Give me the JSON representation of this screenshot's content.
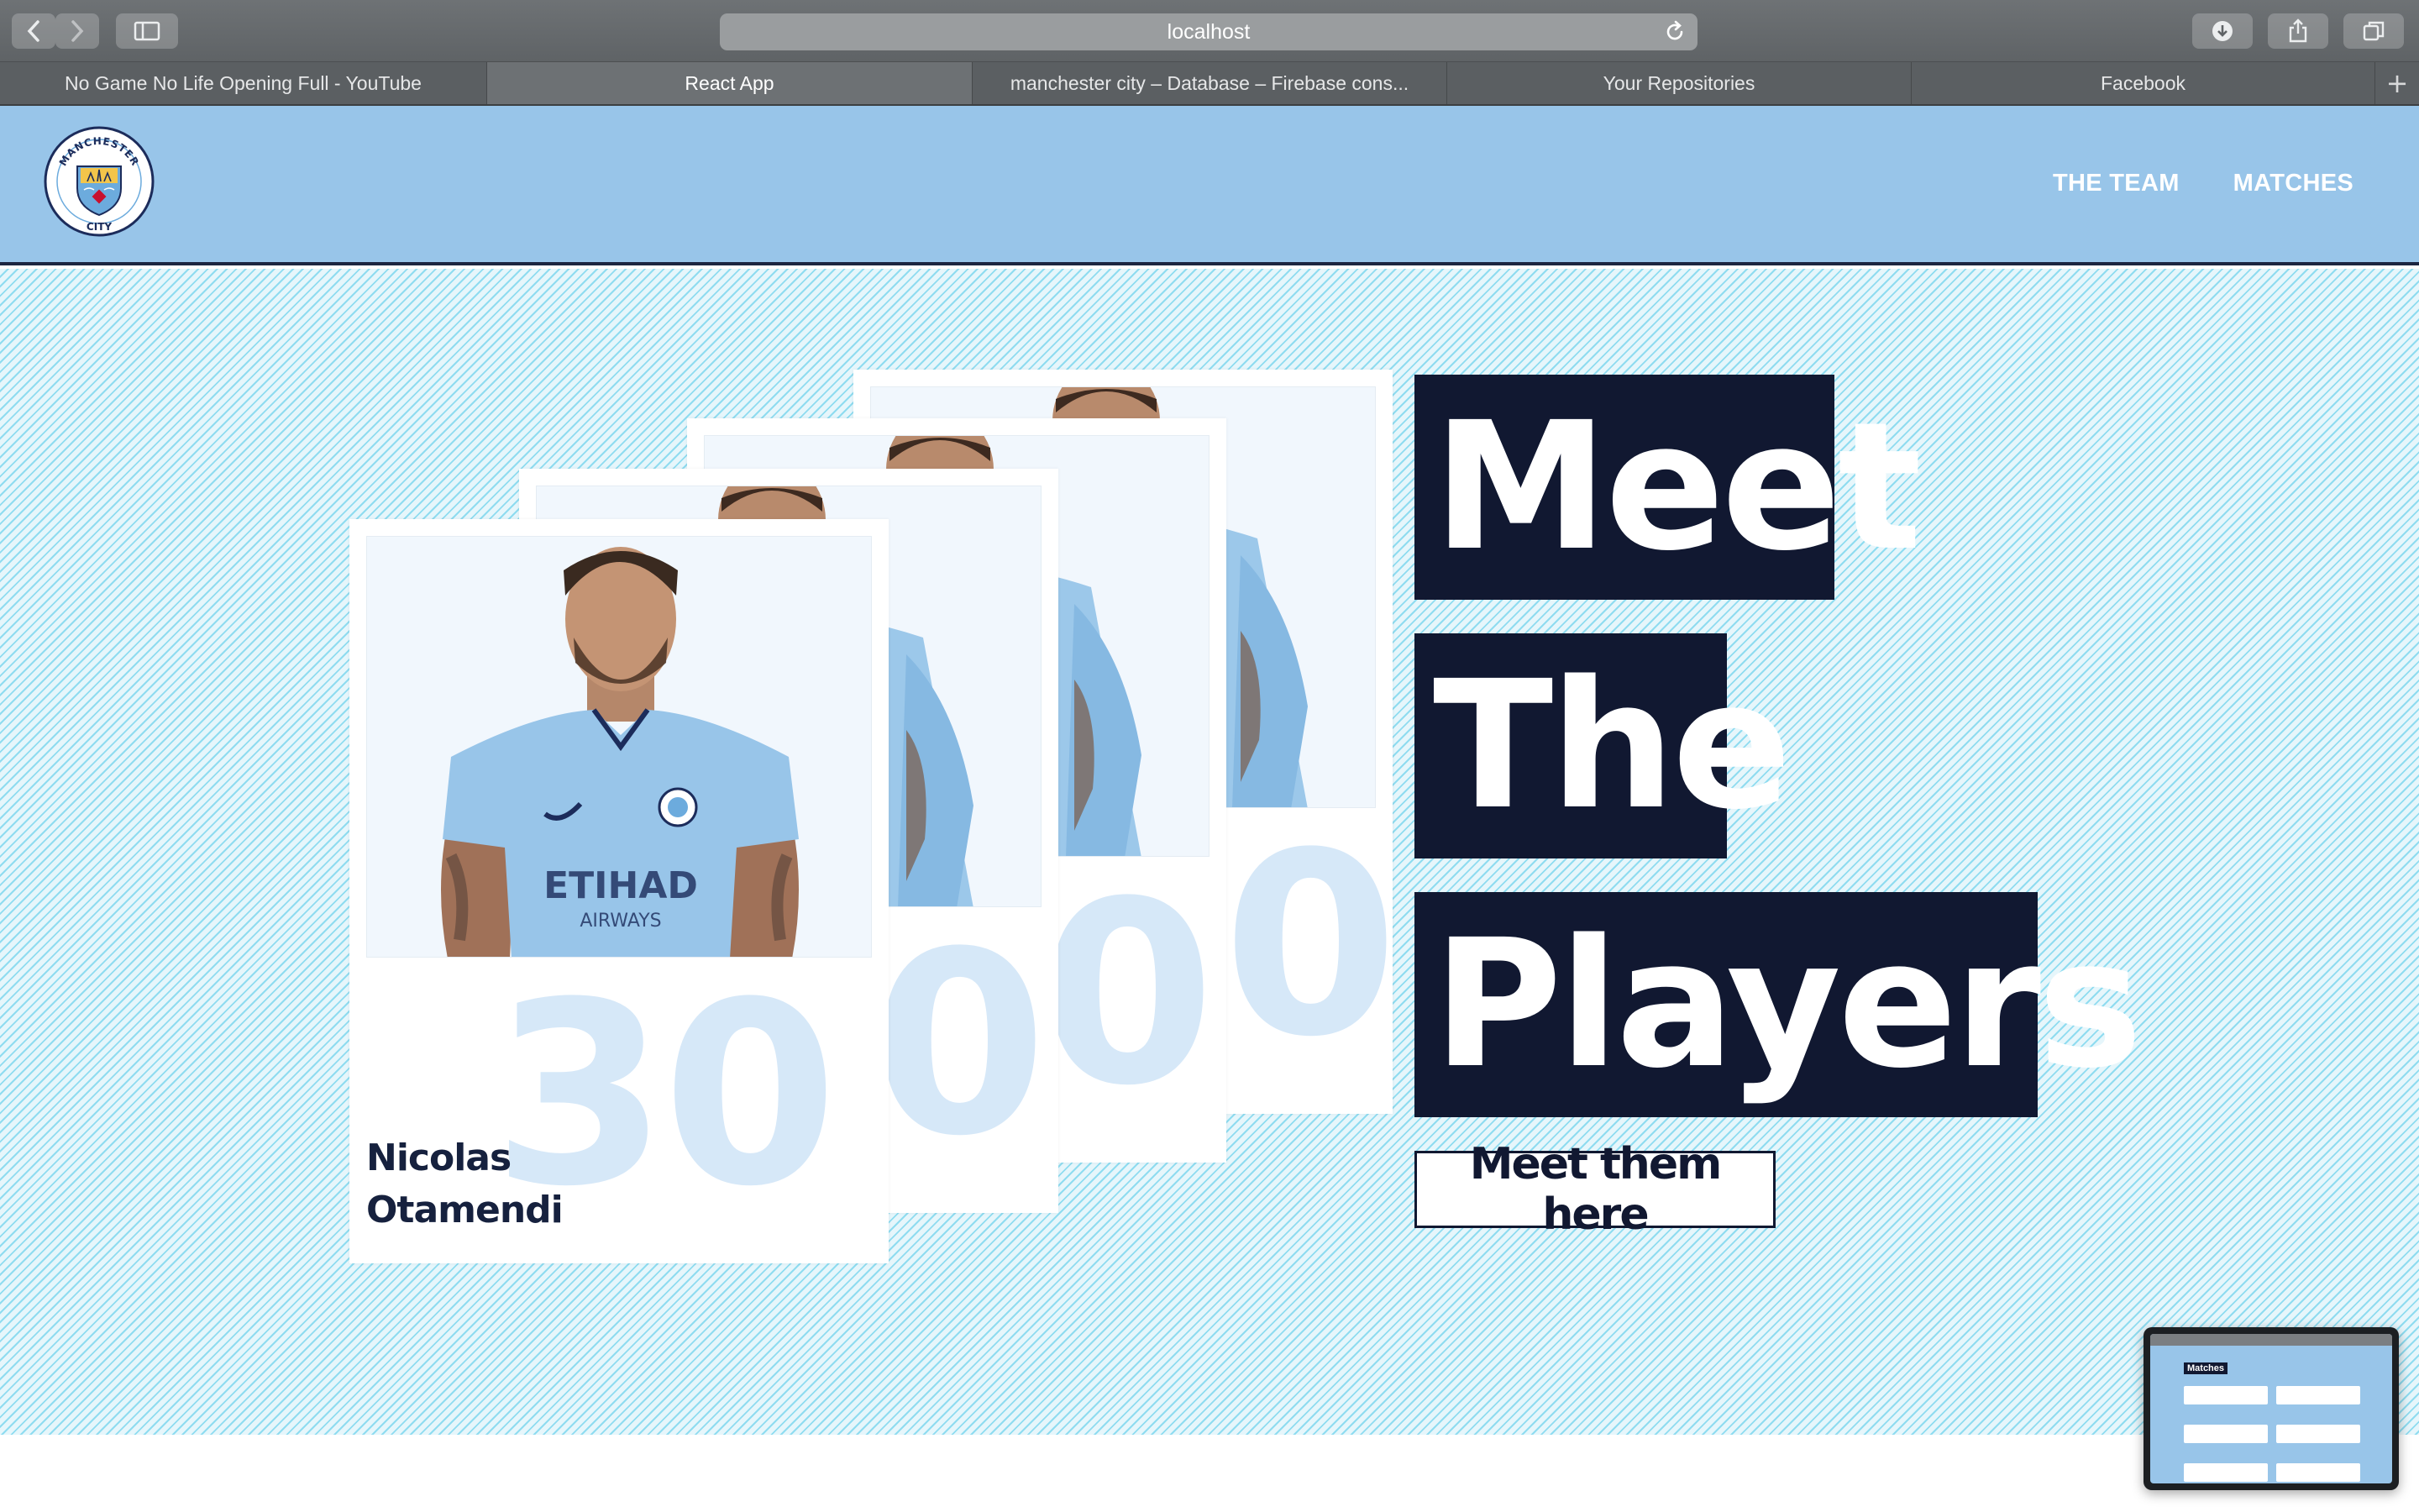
{
  "browser": {
    "url": "localhost",
    "tabs": [
      {
        "label": "No Game No Life Opening Full - YouTube",
        "active": false
      },
      {
        "label": "React App",
        "active": true
      },
      {
        "label": "manchester city – Database – Firebase cons...",
        "active": false
      },
      {
        "label": "Your Repositories",
        "active": false
      },
      {
        "label": "Facebook",
        "active": false
      }
    ],
    "new_tab_symbol": "+"
  },
  "header": {
    "logo": {
      "top_text": "MANCHESTER",
      "bottom_text": "CITY",
      "icon": "club-crest-icon"
    },
    "nav": [
      {
        "label": "THE TEAM"
      },
      {
        "label": "MATCHES"
      }
    ]
  },
  "hero": {
    "featured_player": {
      "first_name": "Nicolas",
      "last_name": "Otamendi",
      "number": "30"
    },
    "back_card_number_glyph": "0",
    "title_lines": [
      "Meet",
      "The",
      "Players"
    ],
    "cta_label": "Meet them here"
  },
  "preview": {
    "title": "Matches"
  },
  "colors": {
    "header_bg": "#98c5e9",
    "navy": "#111831",
    "stripe": "#8fdcf0",
    "number_ghost": "#d6e8f8"
  }
}
